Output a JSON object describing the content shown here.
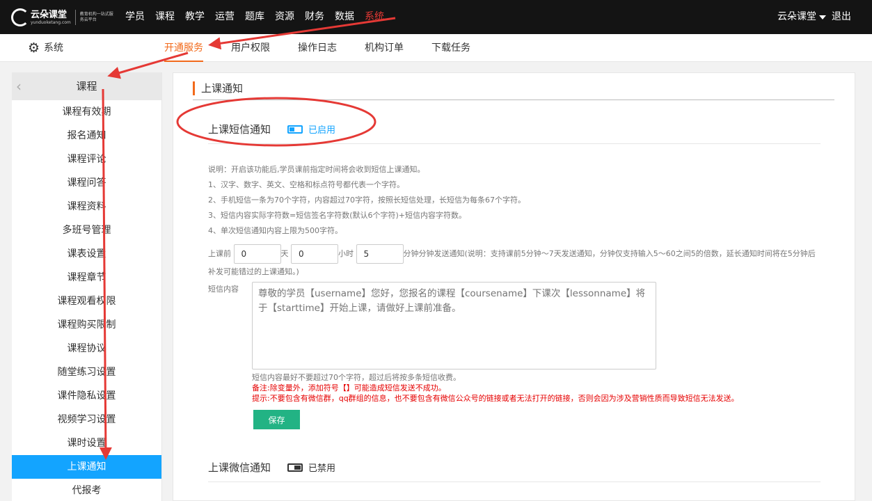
{
  "topbar": {
    "logo_name": "云朵课堂",
    "logo_domain": "yunduoketang.com",
    "logo_slogan": "教育机构一站式服务云平台",
    "nav": [
      {
        "label": "学员",
        "active": false
      },
      {
        "label": "课程",
        "active": false
      },
      {
        "label": "教学",
        "active": false
      },
      {
        "label": "运营",
        "active": false
      },
      {
        "label": "题库",
        "active": false
      },
      {
        "label": "资源",
        "active": false
      },
      {
        "label": "财务",
        "active": false
      },
      {
        "label": "数据",
        "active": false
      },
      {
        "label": "系统",
        "active": true
      }
    ],
    "user_name": "云朵课堂",
    "logout": "退出"
  },
  "subbar": {
    "section": "系统",
    "tabs": [
      {
        "label": "开通服务",
        "active": true
      },
      {
        "label": "用户权限",
        "active": false
      },
      {
        "label": "操作日志",
        "active": false
      },
      {
        "label": "机构订单",
        "active": false
      },
      {
        "label": "下载任务",
        "active": false
      }
    ]
  },
  "sidebar": {
    "title": "课程",
    "items": [
      {
        "label": "课程有效期",
        "active": false
      },
      {
        "label": "报名通知",
        "active": false
      },
      {
        "label": "课程评论",
        "active": false
      },
      {
        "label": "课程问答",
        "active": false
      },
      {
        "label": "课程资料",
        "active": false
      },
      {
        "label": "多班号管理",
        "active": false
      },
      {
        "label": "课表设置",
        "active": false
      },
      {
        "label": "课程章节",
        "active": false
      },
      {
        "label": "课程观看权限",
        "active": false
      },
      {
        "label": "课程购买限制",
        "active": false
      },
      {
        "label": "课程协议",
        "active": false
      },
      {
        "label": "随堂练习设置",
        "active": false
      },
      {
        "label": "课件隐私设置",
        "active": false
      },
      {
        "label": "视频学习设置",
        "active": false
      },
      {
        "label": "课时设置",
        "active": false
      },
      {
        "label": "上课通知",
        "active": true
      },
      {
        "label": "代报考",
        "active": false
      }
    ]
  },
  "main": {
    "title": "上课通知",
    "sms": {
      "name": "上课短信通知",
      "status": "已启用",
      "enabled": true,
      "desc": [
        "说明：开启该功能后,学员课前指定时间将会收到短信上课通知。",
        "1、汉字、数字、英文、空格和标点符号都代表一个字符。",
        "2、手机短信一条为70个字符，内容超过70字符，按照长短信处理，长短信为每条67个字符。",
        "3、短信内容实际字符数=短信签名字符数(默认6个字符)+短信内容字符数。",
        "4、单次短信通知内容上限为500字符。"
      ],
      "before_label": "上课前",
      "days_value": "0",
      "days_unit": "天",
      "hours_value": "0",
      "hours_unit": "小时",
      "minutes_value": "5",
      "minutes_hint": "分钟分钟发送通知(说明：支持课前5分钟～7天发送通知，分钟仅支持输入5～60之间5的倍数，延长通知时间将在5分钟后补发可能错过的上课通知。)",
      "content_label": "短信内容",
      "content_placeholder": "尊敬的学员【username】您好，您报名的课程【coursename】下课次【lessonname】将于【starttime】开始上课，请做好上课前准备。",
      "note1": "短信内容最好不要超过70个字符，超过后将按多条短信收费。",
      "note2": "备注:除变量外，添加符号【】可能造成短信发送不成功。",
      "note3": "提示:不要包含有微信群，qq群组的信息，也不要包含有微信公众号的链接或者无法打开的链接，否则会因为涉及营销性质而导致短信无法发送。",
      "save_label": "保存"
    },
    "wechat": {
      "name": "上课微信通知",
      "status": "已禁用",
      "enabled": false
    }
  },
  "colors": {
    "accent_orange": "#f26a1b",
    "active_blue": "#13a4ff",
    "annotation_red": "#e53935",
    "save_green": "#22b384"
  }
}
